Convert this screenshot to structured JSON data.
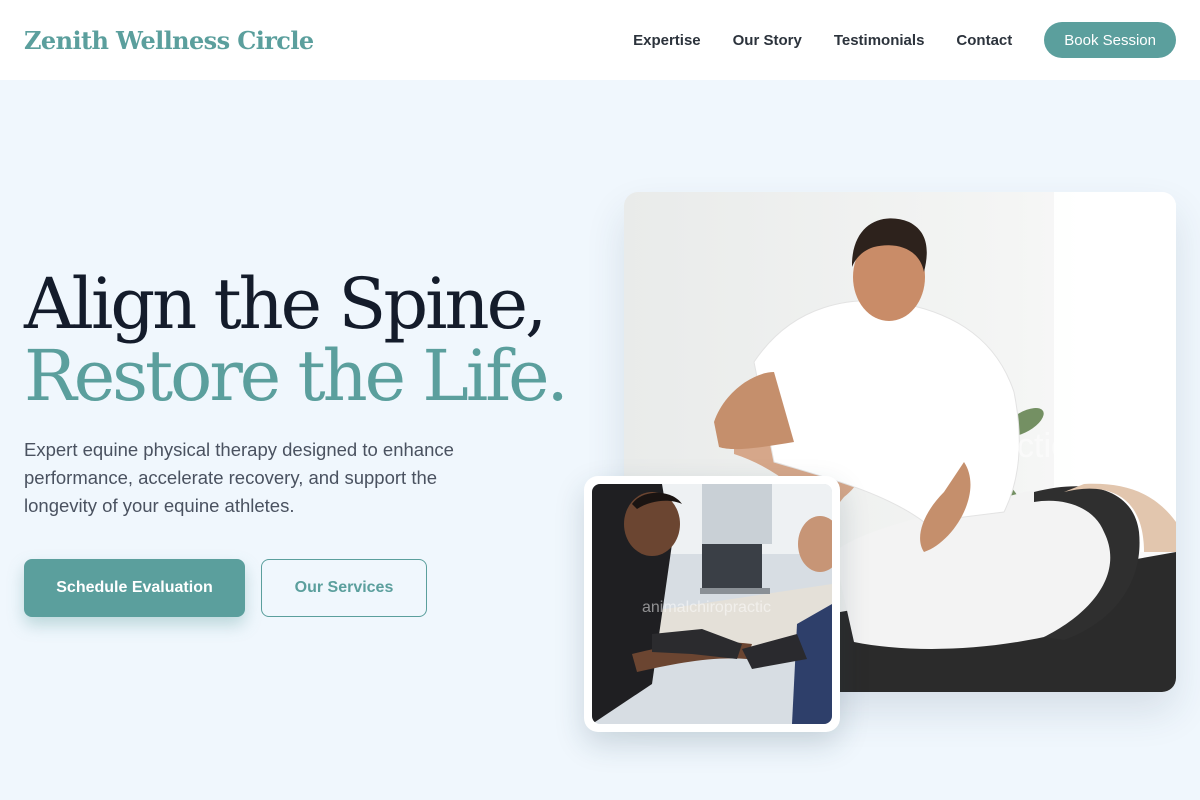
{
  "brand": {
    "name": "Zenith Wellness Circle",
    "accent": "#5b9f9d"
  },
  "nav": {
    "links": [
      "Expertise",
      "Our Story",
      "Testimonials",
      "Contact"
    ],
    "cta": "Book Session"
  },
  "hero": {
    "title_line1": "Align the Spine,",
    "title_line2": "Restore the Life.",
    "lead": "Expert equine physical therapy designed to enhance performance, accelerate recovery, and support the longevity of your equine athletes.",
    "primary_cta": "Schedule Evaluation",
    "secondary_cta": "Our Services"
  },
  "images": {
    "main": "therapist-treating-patient-photo",
    "secondary": "prosthetic-arm-fitting-photo",
    "watermark": "animalchiropractic"
  },
  "colors": {
    "background": "#f0f7fd",
    "heading_dark": "#141c2b",
    "text_muted": "#4a5260"
  }
}
